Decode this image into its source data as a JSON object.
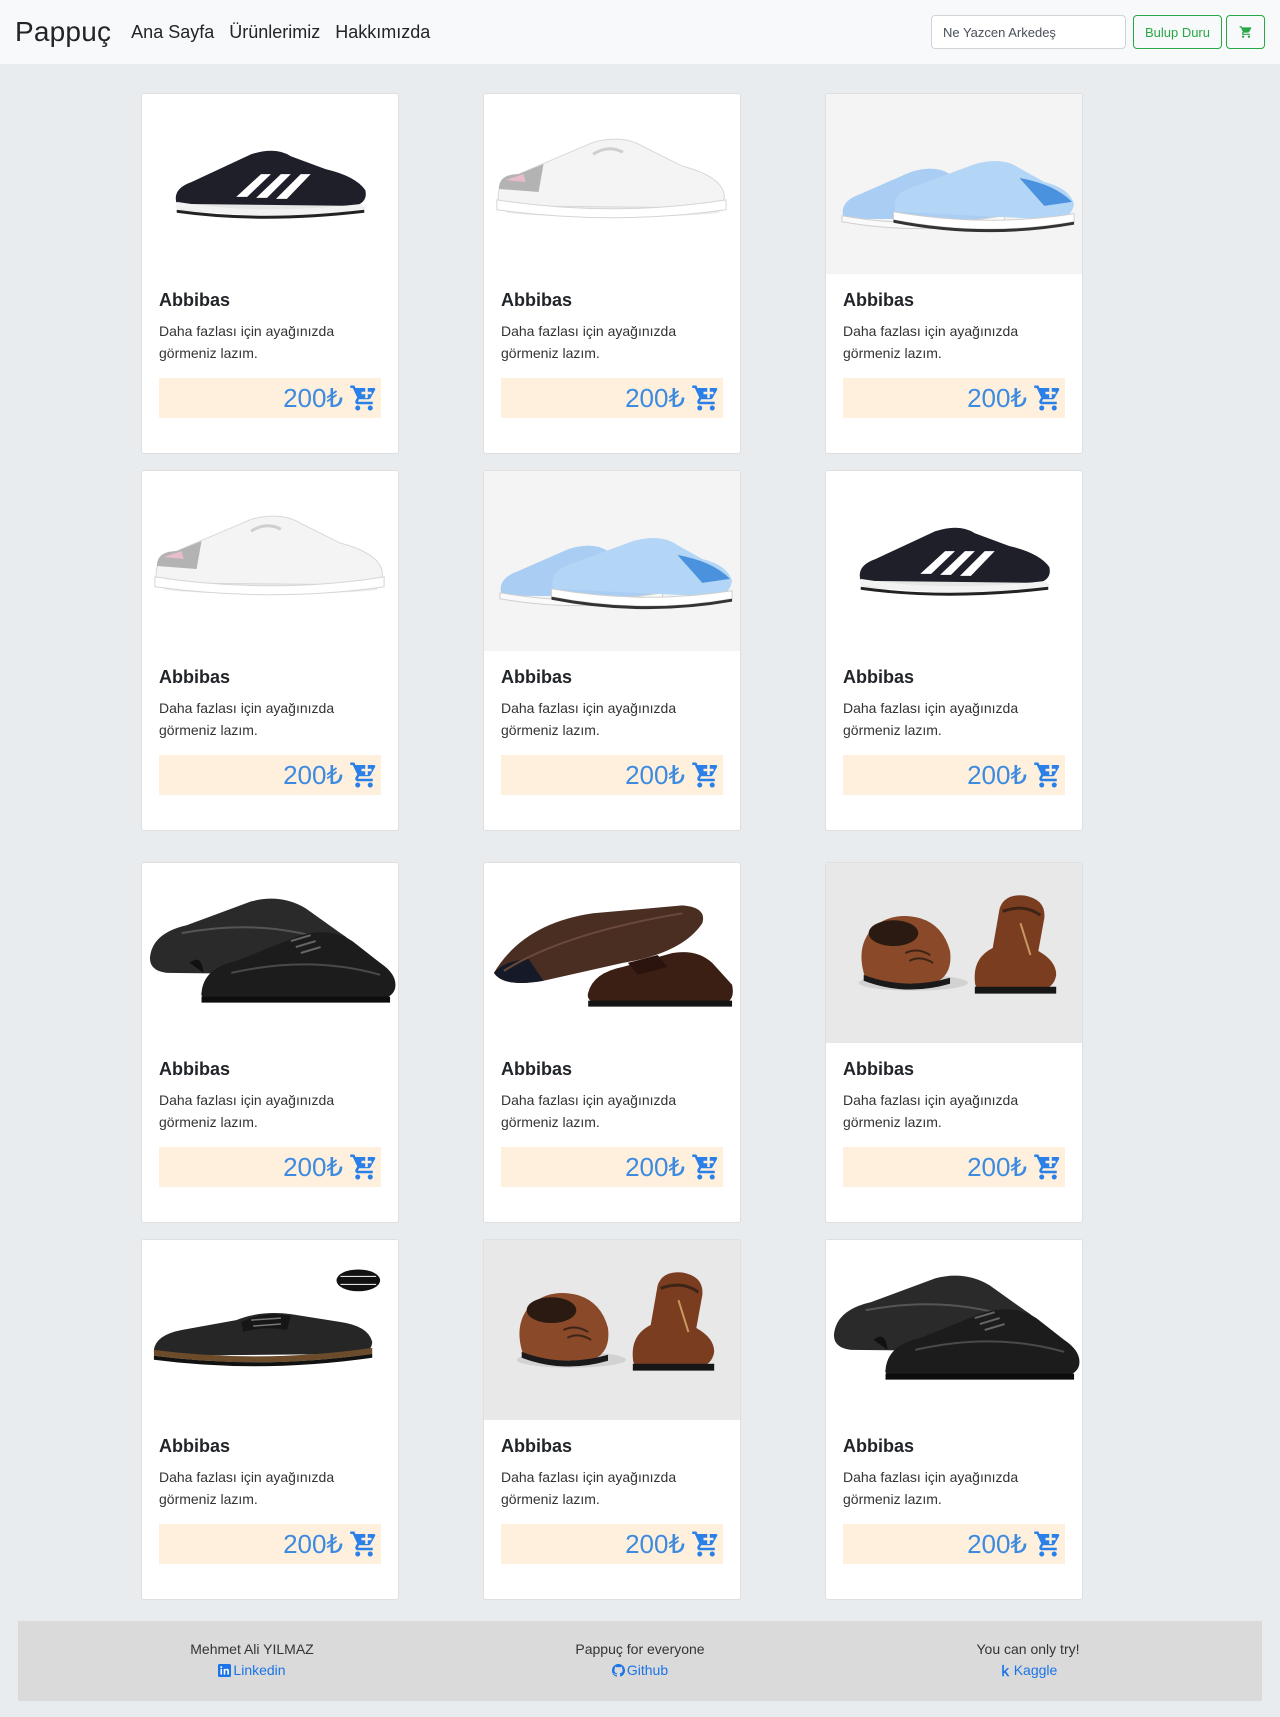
{
  "navbar": {
    "brand": "Pappuç",
    "links": [
      "Ana Sayfa",
      "Ürünlerimiz",
      "Hakkımızda"
    ],
    "search_placeholder": "Ne Yazcen Arkedeş",
    "search_button": "Bulup Duru",
    "cart_icon": "cart-icon"
  },
  "products": [
    {
      "title": "Abbibas",
      "text": "Daha fazlası için ayağınızda görmeniz lazım.",
      "price": "200₺",
      "image": "black-sneaker"
    },
    {
      "title": "Abbibas",
      "text": "Daha fazlası için ayağınızda görmeniz lazım.",
      "price": "200₺",
      "image": "white-sneaker"
    },
    {
      "title": "Abbibas",
      "text": "Daha fazlası için ayağınızda görmeniz lazım.",
      "price": "200₺",
      "image": "blue-sneakers"
    },
    {
      "title": "Abbibas",
      "text": "Daha fazlası için ayağınızda görmeniz lazım.",
      "price": "200₺",
      "image": "white-sneaker"
    },
    {
      "title": "Abbibas",
      "text": "Daha fazlası için ayağınızda görmeniz lazım.",
      "price": "200₺",
      "image": "blue-sneakers"
    },
    {
      "title": "Abbibas",
      "text": "Daha fazlası için ayağınızda görmeniz lazım.",
      "price": "200₺",
      "image": "black-sneaker"
    },
    {
      "title": "Abbibas",
      "text": "Daha fazlası için ayağınızda görmeniz lazım.",
      "price": "200₺",
      "image": "black-oxford-pair"
    },
    {
      "title": "Abbibas",
      "text": "Daha fazlası için ayağınızda görmeniz lazım.",
      "price": "200₺",
      "image": "brown-oxford-sole"
    },
    {
      "title": "Abbibas",
      "text": "Daha fazlası için ayağınızda görmeniz lazım.",
      "price": "200₺",
      "image": "brown-boots"
    },
    {
      "title": "Abbibas",
      "text": "Daha fazlası için ayağınızda görmeniz lazım.",
      "price": "200₺",
      "image": "black-loafer"
    },
    {
      "title": "Abbibas",
      "text": "Daha fazlası için ayağınızda görmeniz lazım.",
      "price": "200₺",
      "image": "brown-boots"
    },
    {
      "title": "Abbibas",
      "text": "Daha fazlası için ayağınızda görmeniz lazım.",
      "price": "200₺",
      "image": "black-oxford-pair"
    }
  ],
  "footer": [
    {
      "text": "Mehmet Ali YILMAZ",
      "link": "Linkedin",
      "icon": "linkedin-icon"
    },
    {
      "text": "Pappuç for everyone",
      "link": "Github",
      "icon": "github-icon"
    },
    {
      "text": "You can only try!",
      "link": "Kaggle",
      "icon": "kaggle-icon"
    }
  ],
  "colors": {
    "page_bg": "#e9ecef",
    "navbar_bg": "#f8f9fa",
    "accent_green": "#28a745",
    "price_bg": "#fef0dc",
    "price_text": "#3d8be0",
    "link_blue": "#1a73e8",
    "footer_bg": "#dadada"
  }
}
